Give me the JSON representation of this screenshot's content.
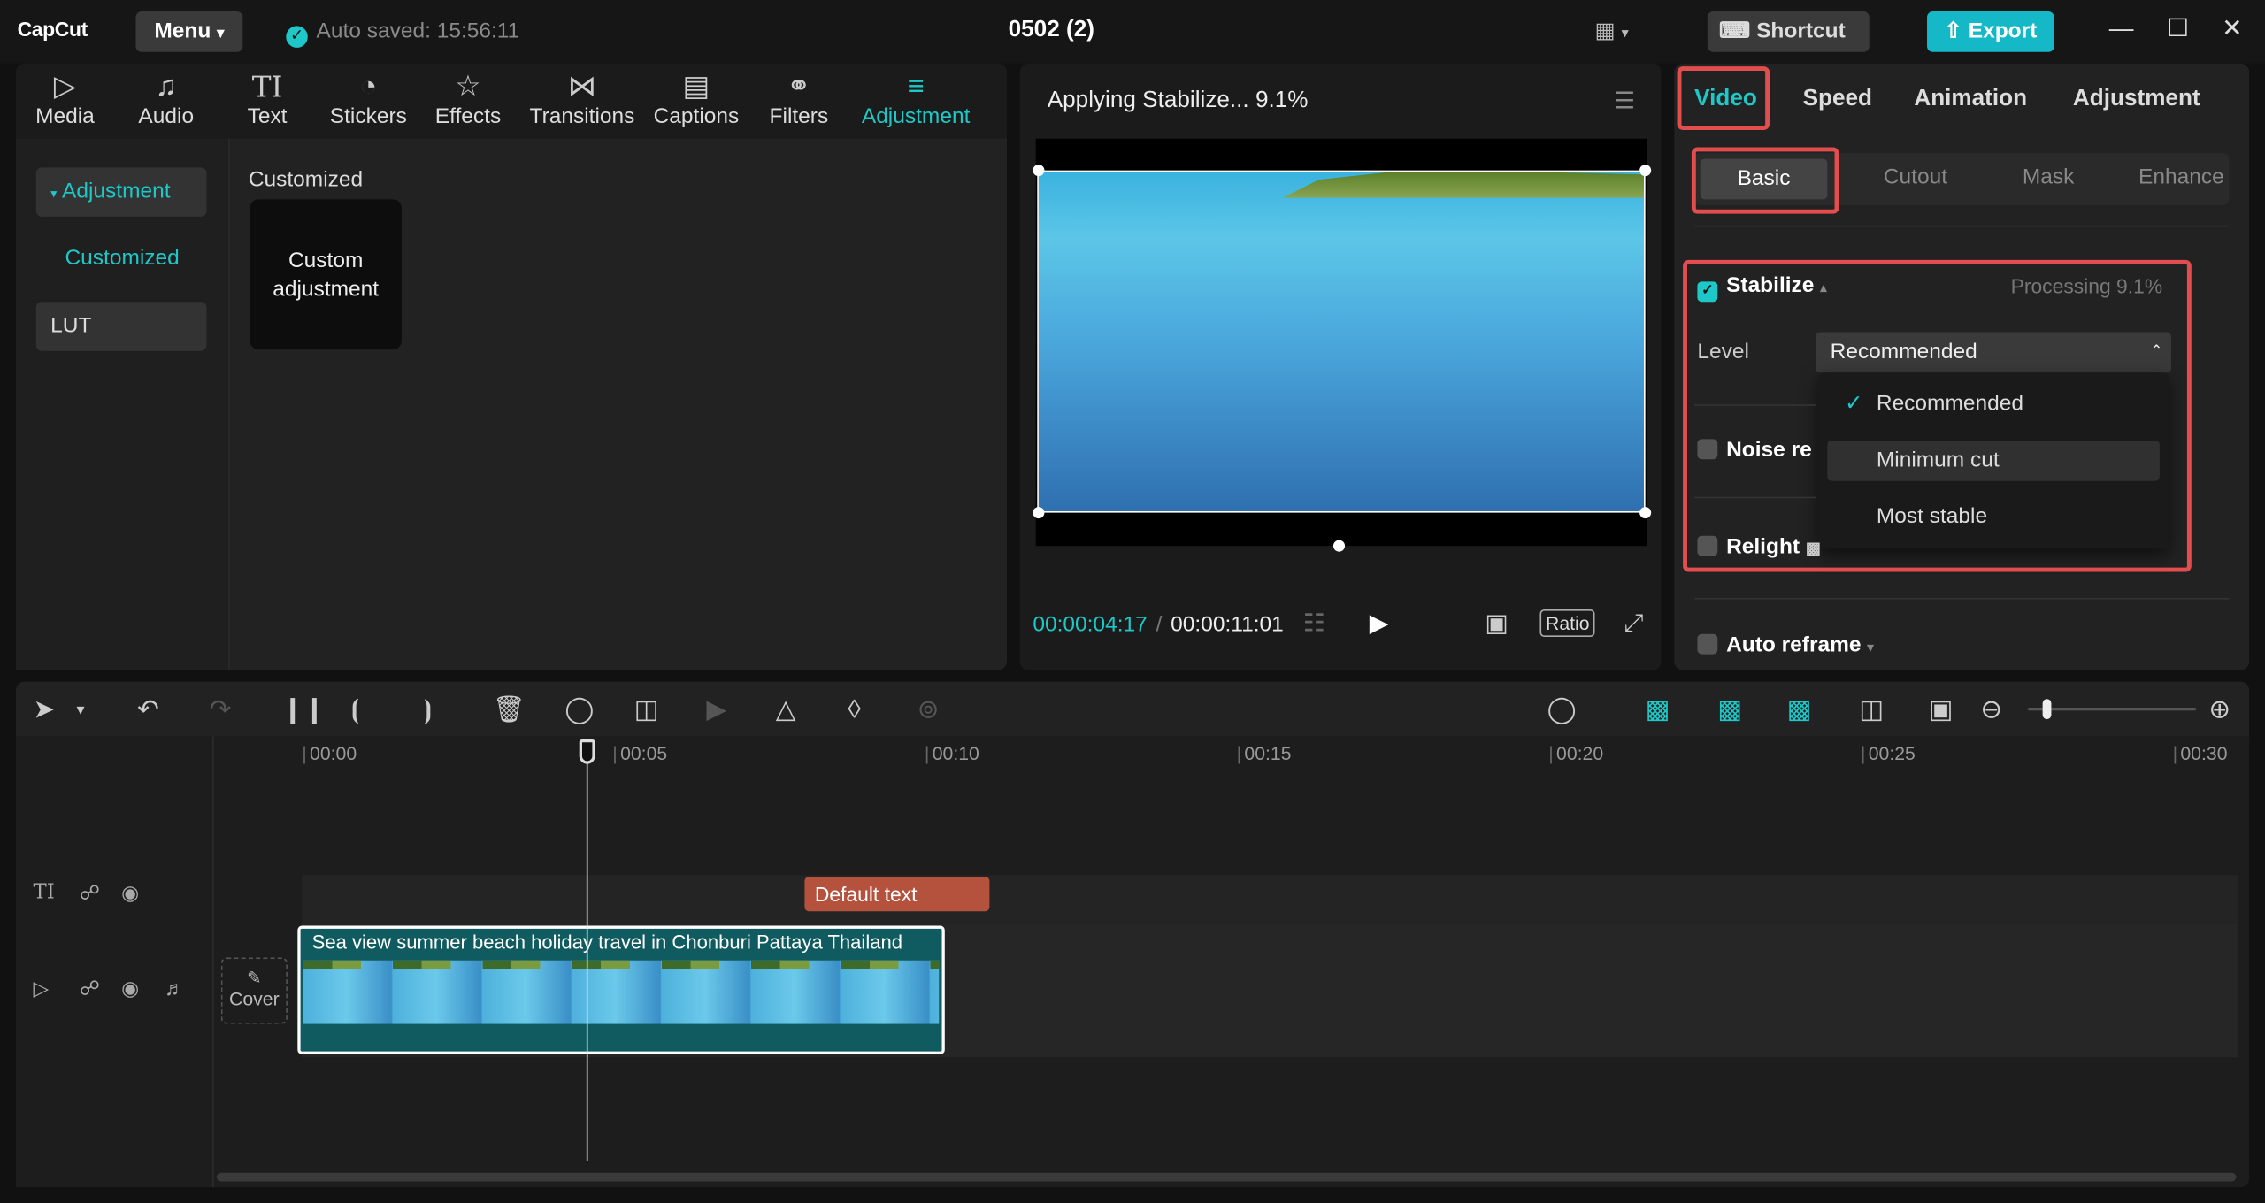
{
  "app": {
    "logo": "CapCut",
    "menu_label": "Menu",
    "autosave": "Auto saved: 15:56:11",
    "project_title": "0502 (2)",
    "shortcut_label": "Shortcut",
    "export_label": "Export"
  },
  "left_tabs": [
    {
      "label": "Media",
      "icon": "media-icon"
    },
    {
      "label": "Audio",
      "icon": "audio-icon"
    },
    {
      "label": "Text",
      "icon": "text-icon"
    },
    {
      "label": "Stickers",
      "icon": "stickers-icon"
    },
    {
      "label": "Effects",
      "icon": "effects-icon"
    },
    {
      "label": "Transitions",
      "icon": "transitions-icon"
    },
    {
      "label": "Captions",
      "icon": "captions-icon"
    },
    {
      "label": "Filters",
      "icon": "filters-icon"
    },
    {
      "label": "Adjustment",
      "icon": "adjustment-icon",
      "active": true
    }
  ],
  "side_nav": {
    "items": [
      {
        "label": "Adjustment",
        "active": true
      },
      {
        "label": "Customized"
      },
      {
        "label": "LUT"
      }
    ]
  },
  "adjust_content": {
    "section_label": "Customized",
    "card_label": "Custom adjustment"
  },
  "player": {
    "title": "Applying Stabilize... 9.1%",
    "current_time": "00:00:04:17",
    "total_time": "00:00:11:01",
    "ratio_label": "Ratio"
  },
  "right_panel": {
    "tabs": [
      "Video",
      "Speed",
      "Animation",
      "Adjustment"
    ],
    "active_tab": "Video",
    "subtabs": [
      "Basic",
      "Cutout",
      "Mask",
      "Enhance"
    ],
    "active_subtab": "Basic",
    "stabilize": {
      "label": "Stabilize",
      "checked": true,
      "status": "Processing 9.1%",
      "level_label": "Level",
      "level_value": "Recommended",
      "options": [
        "Recommended",
        "Minimum cut",
        "Most stable"
      ],
      "selected_option": "Recommended",
      "hovered_option": "Minimum cut"
    },
    "noise_reduction_label": "Noise re",
    "relight_label": "Relight",
    "auto_reframe_label": "Auto reframe"
  },
  "timeline": {
    "ruler": [
      "00:00",
      "00:05",
      "00:10",
      "00:15",
      "00:20",
      "00:25",
      "00:30"
    ],
    "text_clip": "Default text",
    "video_clip_title": "Sea view summer beach holiday travel in Chonburi Pattaya Thailand",
    "cover_label": "Cover"
  },
  "colors": {
    "accent": "#1ec8c8",
    "highlight_box": "#e24d4d",
    "text_clip": "#b5523d",
    "export": "#14b8c6"
  }
}
